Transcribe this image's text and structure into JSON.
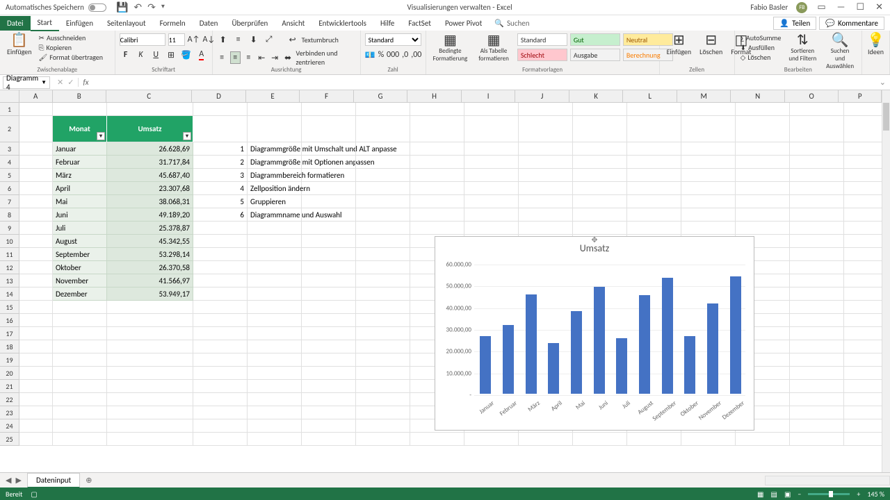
{
  "titlebar": {
    "autosave": "Automatisches Speichern",
    "doc_title": "Visualisierungen verwalten - Excel",
    "user": "Fabio Basler",
    "initials": "FB"
  },
  "tabs": {
    "file": "Datei",
    "items": [
      "Start",
      "Einfügen",
      "Seitenlayout",
      "Formeln",
      "Daten",
      "Überprüfen",
      "Ansicht",
      "Entwicklertools",
      "Hilfe",
      "FactSet",
      "Power Pivot"
    ],
    "active": "Start",
    "search": "Suchen",
    "share": "Teilen",
    "comments": "Kommentare"
  },
  "ribbon": {
    "paste": "Einfügen",
    "cut": "Ausschneiden",
    "copy": "Kopieren",
    "format_painter": "Format übertragen",
    "clipboard": "Zwischenablage",
    "font_name": "Calibri",
    "font_size": "11",
    "font_group": "Schriftart",
    "wrap": "Textumbruch",
    "merge": "Verbinden und zentrieren",
    "align_group": "Ausrichtung",
    "number_format": "Standard",
    "number_group": "Zahl",
    "cond_fmt": "Bedingte Formatierung",
    "as_table": "Als Tabelle formatieren",
    "style_standard": "Standard",
    "style_gut": "Gut",
    "style_neutral": "Neutral",
    "style_schlecht": "Schlecht",
    "style_ausgabe": "Ausgabe",
    "style_berechnung": "Berechnung",
    "styles_group": "Formatvorlagen",
    "insert": "Einfügen",
    "delete": "Löschen",
    "format": "Format",
    "cells_group": "Zellen",
    "autosum": "AutoSumme",
    "fill": "Ausfüllen",
    "clear": "Löschen",
    "sort": "Sortieren und Filtern",
    "find": "Suchen und Auswählen",
    "edit_group": "Bearbeiten",
    "ideas": "Ideen"
  },
  "namebox": "Diagramm 4",
  "columns": [
    "A",
    "B",
    "C",
    "D",
    "E",
    "F",
    "G",
    "H",
    "I",
    "J",
    "K",
    "L",
    "M",
    "N",
    "O",
    "P"
  ],
  "table": {
    "h1": "Monat",
    "h2": "Umsatz",
    "rows": [
      {
        "m": "Januar",
        "v": "26.628,69"
      },
      {
        "m": "Februar",
        "v": "31.717,84"
      },
      {
        "m": "März",
        "v": "45.687,40"
      },
      {
        "m": "April",
        "v": "23.307,68"
      },
      {
        "m": "Mai",
        "v": "38.068,31"
      },
      {
        "m": "Juni",
        "v": "49.189,20"
      },
      {
        "m": "Juli",
        "v": "25.378,87"
      },
      {
        "m": "August",
        "v": "45.342,55"
      },
      {
        "m": "September",
        "v": "53.298,14"
      },
      {
        "m": "Oktober",
        "v": "26.370,58"
      },
      {
        "m": "November",
        "v": "41.566,97"
      },
      {
        "m": "Dezember",
        "v": "53.949,17"
      }
    ]
  },
  "notes": [
    {
      "n": "1",
      "t": "Diagrammgröße mit Umschalt und ALT anpasse"
    },
    {
      "n": "2",
      "t": "Diagrammgröße mit Optionen anpassen"
    },
    {
      "n": "3",
      "t": "Diagrammbereich formatieren"
    },
    {
      "n": "4",
      "t": "Zellposition ändern"
    },
    {
      "n": "5",
      "t": "Gruppieren"
    },
    {
      "n": "6",
      "t": "Diagrammname und Auswahl"
    }
  ],
  "chart_data": {
    "type": "bar",
    "title": "Umsatz",
    "categories": [
      "Januar",
      "Februar",
      "März",
      "April",
      "Mai",
      "Juni",
      "Juli",
      "August",
      "September",
      "Oktober",
      "November",
      "Dezember"
    ],
    "values": [
      26628.69,
      31717.84,
      45687.4,
      23307.68,
      38068.31,
      49189.2,
      25378.87,
      45342.55,
      53298.14,
      26370.58,
      41566.97,
      53949.17
    ],
    "ylim": [
      0,
      60000
    ],
    "yticks": [
      "-",
      "10.000,00",
      "20.000,00",
      "30.000,00",
      "40.000,00",
      "50.000,00",
      "60.000,00"
    ],
    "xlabel": "",
    "ylabel": ""
  },
  "sheet": "Dateninput",
  "status": {
    "ready": "Bereit",
    "zoom": "145 %"
  }
}
